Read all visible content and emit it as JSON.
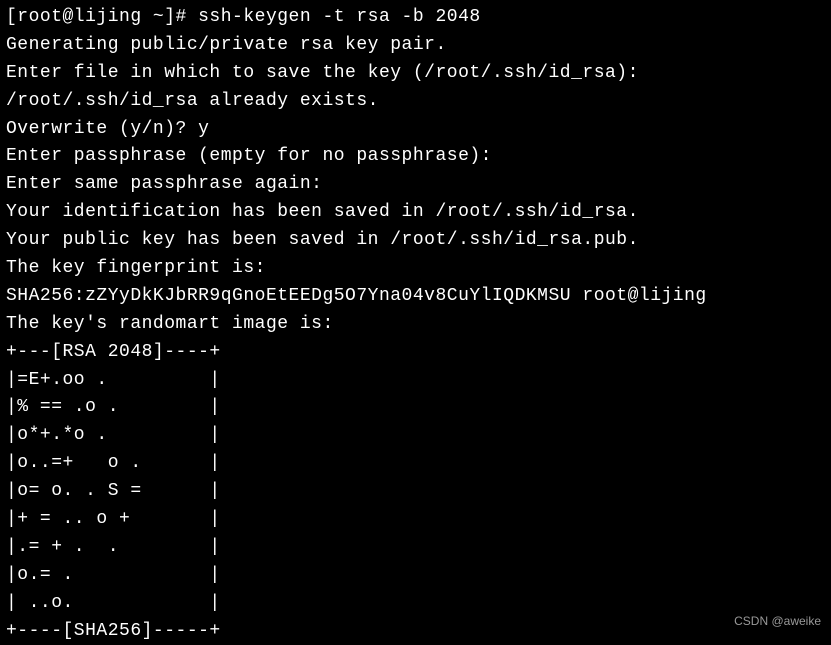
{
  "terminal": {
    "lines": [
      "[root@lijing ~]# ssh-keygen -t rsa -b 2048",
      "Generating public/private rsa key pair.",
      "Enter file in which to save the key (/root/.ssh/id_rsa):",
      "/root/.ssh/id_rsa already exists.",
      "Overwrite (y/n)? y",
      "Enter passphrase (empty for no passphrase):",
      "Enter same passphrase again:",
      "Your identification has been saved in /root/.ssh/id_rsa.",
      "Your public key has been saved in /root/.ssh/id_rsa.pub.",
      "The key fingerprint is:",
      "SHA256:zZYyDkKJbRR9qGnoEtEEDg5O7Yna04v8CuYlIQDKMSU root@lijing",
      "The key's randomart image is:",
      "+---[RSA 2048]----+",
      "|=E+.oo .         |",
      "|% == .o .        |",
      "|o*+.*o .         |",
      "|o..=+   o .      |",
      "|o= o. . S =      |",
      "|+ = .. o +       |",
      "|.= + .  .        |",
      "|o.= .            |",
      "| ..o.            |",
      "+----[SHA256]-----+"
    ]
  },
  "watermark": "CSDN @aweike"
}
